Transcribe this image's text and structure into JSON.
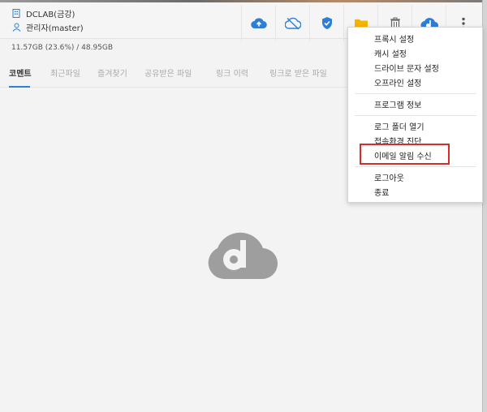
{
  "header": {
    "org_name": "DCLAB(금강)",
    "user_name": "관리자(master)"
  },
  "storage_text": "11.57GB (23.6%) / 48.95GB",
  "tabs": [
    {
      "label": "코멘트"
    },
    {
      "label": "최근파일"
    },
    {
      "label": "즐겨찾기"
    },
    {
      "label": "공유받은 파일"
    },
    {
      "label": "링크 이력"
    },
    {
      "label": "링크로 받은 파일"
    }
  ],
  "toolbar": {
    "icons": [
      "cloud-upload-icon",
      "cloud-off-icon",
      "shield-check-icon",
      "folder-icon",
      "trash-icon",
      "app-logo-icon",
      "more-vertical-icon"
    ]
  },
  "menu": {
    "items": [
      {
        "label": "프록시 설정"
      },
      {
        "label": "캐시 설정"
      },
      {
        "label": "드라이브 문자 설정"
      },
      {
        "label": "오프라인 설정"
      },
      {
        "label": "프로그램 정보"
      },
      {
        "label": "로그 폴더 열기"
      },
      {
        "label": "접속환경 진단"
      },
      {
        "label": "이메일 알림 수신"
      },
      {
        "label": "로그아웃"
      },
      {
        "label": "종료"
      }
    ]
  },
  "colors": {
    "accent_blue": "#2b7fd6",
    "folder_yellow": "#f5b400",
    "highlight_red": "#d62c2c",
    "logo_gray": "#9e9e9e"
  }
}
